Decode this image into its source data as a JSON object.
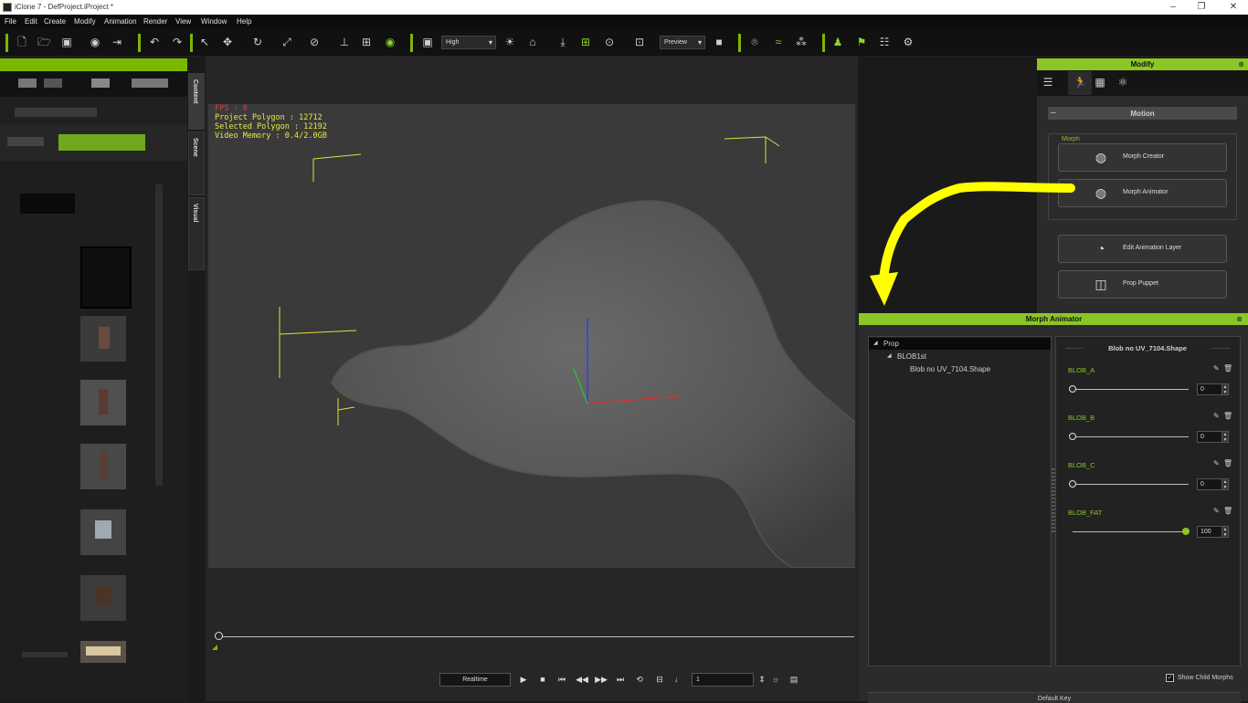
{
  "window": {
    "title": "iClone 7 - DefProject.iProject *",
    "minimize": "–",
    "maximize": "❐",
    "close": "✕"
  },
  "menu": [
    "File",
    "Edit",
    "Create",
    "Modify",
    "Animation",
    "Render",
    "View",
    "Window",
    "Help"
  ],
  "toolbar": {
    "quality": "High",
    "preview": "Preview"
  },
  "side_tabs": [
    "Content",
    "Scene",
    "Visual"
  ],
  "viewport": {
    "fps": "FPS : 0",
    "project_polygon": "Project Polygon : 12712",
    "selected_polygon": "Selected Polygon : 12192",
    "video_memory": "Video Memory : 0.4/2.0GB"
  },
  "playback": {
    "mode": "Realtime",
    "frame": "1"
  },
  "modify": {
    "title": "Modify",
    "section": "Motion",
    "group": "Morph",
    "buttons": {
      "morph_creator": "Morph Creator",
      "morph_animator": "Morph Animator",
      "edit_layer": "Edit Animation Layer",
      "prop_puppet": "Prop Puppet"
    }
  },
  "morph_animator": {
    "title": "Morph Animator",
    "tree": {
      "root": "Prop",
      "child": "BLOB1st",
      "leaf": "Blob no UV_7104.Shape"
    },
    "shape_title": "Blob no UV_7104.Shape",
    "morphs": [
      {
        "name": "BLOB_A",
        "value": "0",
        "level": 0
      },
      {
        "name": "BLOB_B",
        "value": "0",
        "level": 0
      },
      {
        "name": "BLOB_C",
        "value": "0",
        "level": 0
      },
      {
        "name": "BLOB_FAT",
        "value": "100",
        "level": 1
      }
    ],
    "show_child": "Show Child Morphs",
    "default_key": "Default Key"
  },
  "colors": {
    "accent": "#8bc626",
    "hud_text": "#e8e84a",
    "annotation": "#ffff00"
  }
}
